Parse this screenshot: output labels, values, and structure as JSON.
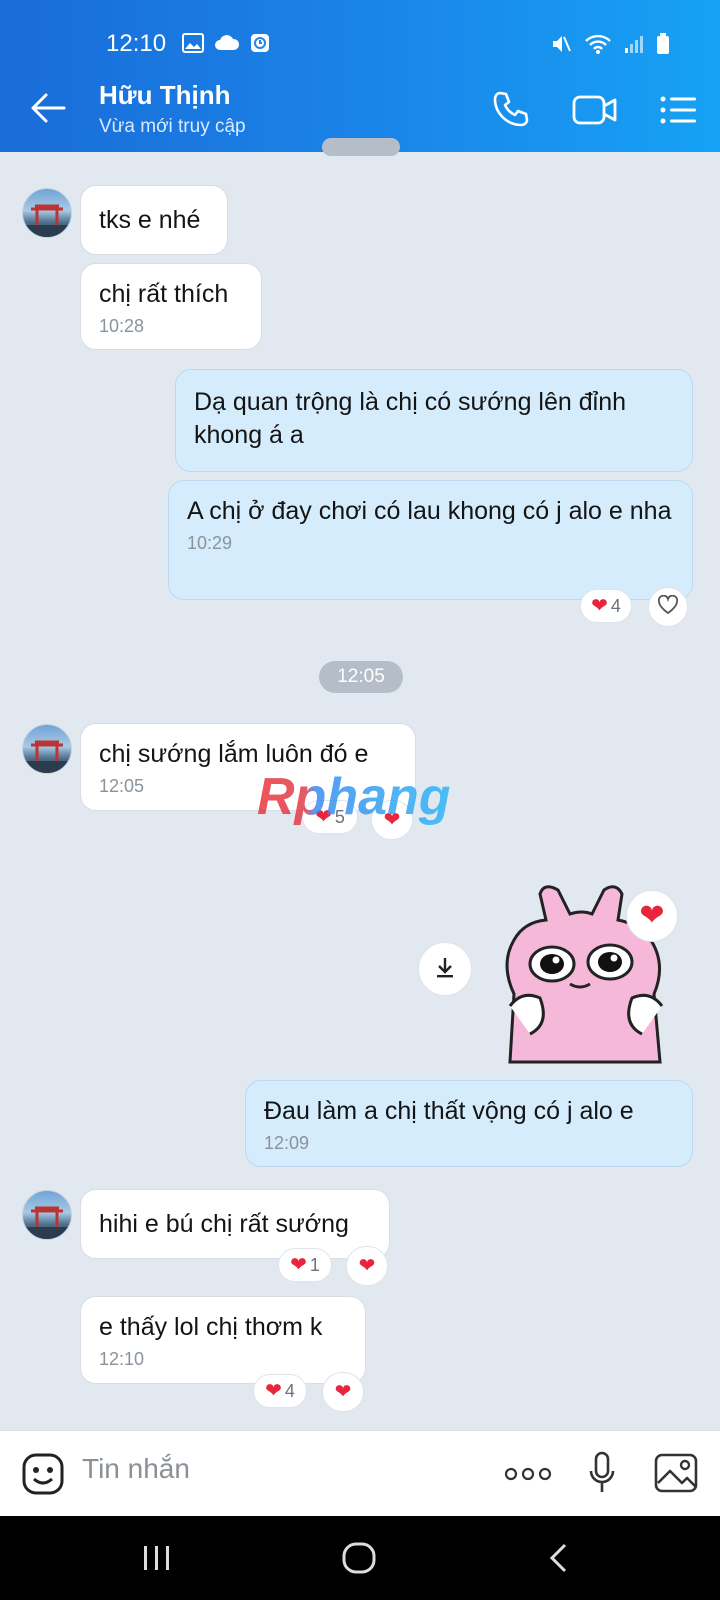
{
  "status_bar": {
    "time": "12:10"
  },
  "header": {
    "contact_name": "Hữu Thịnh",
    "contact_status": "Vừa mới truy cập"
  },
  "watermark": "Rphang",
  "messages": {
    "m1": {
      "text": "tks e nhé"
    },
    "m2": {
      "text": "chị rất thích",
      "time": "10:28"
    },
    "m3": {
      "text": "Dạ quan trộng là chị có sướng lên đỉnh khong á a"
    },
    "m4": {
      "text": "A chị ở đay chơi có lau khong có j alo e nha",
      "time": "10:29",
      "reaction_count": "4"
    },
    "divider_time": "12:05",
    "m5": {
      "text": "chị sướng lắm luôn đó e",
      "time": "12:05",
      "reaction_count": "5"
    },
    "m7": {
      "text": "Đau làm a chị thất vộng có j alo e",
      "time": "12:09"
    },
    "m8": {
      "text": "hihi e bú chị rất sướng",
      "reaction_count": "1"
    },
    "m9": {
      "text": "e thấy lol chị thơm k",
      "time": "12:10",
      "reaction_count": "4"
    }
  },
  "composer": {
    "placeholder": "Tin nhắn"
  },
  "colors": {
    "header_gradient_start": "#1a6cd8",
    "header_gradient_end": "#16a2f4",
    "chat_background": "#e2e8ef",
    "incoming_bubble": "#ffffff",
    "outgoing_bubble": "#d5ecfc",
    "reaction_heart": "#e8253c"
  }
}
